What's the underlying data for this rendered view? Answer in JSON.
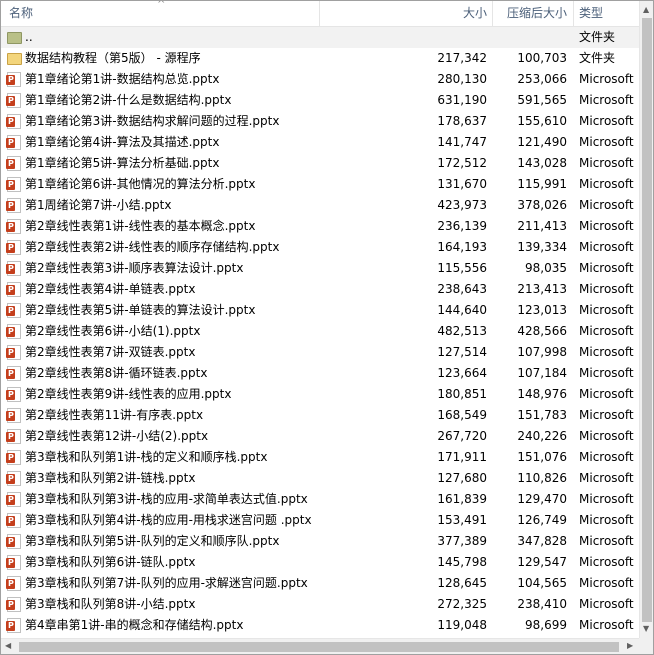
{
  "header": {
    "name": "名称",
    "size": "大小",
    "compressed": "压缩后大小",
    "type": "类型",
    "sort_arrow": "^"
  },
  "rows": [
    {
      "name": "..",
      "size": "",
      "compressed": "",
      "type": "文件夹",
      "icon": "folder-up"
    },
    {
      "name": "数据结构教程（第5版） - 源程序",
      "size": "217,342",
      "compressed": "100,703",
      "type": "文件夹",
      "icon": "folder"
    },
    {
      "name": "第1章绪论第1讲-数据结构总览.pptx",
      "size": "280,130",
      "compressed": "253,066",
      "type": "Microsoft",
      "icon": "pptx"
    },
    {
      "name": "第1章绪论第2讲-什么是数据结构.pptx",
      "size": "631,190",
      "compressed": "591,565",
      "type": "Microsoft",
      "icon": "pptx"
    },
    {
      "name": "第1章绪论第3讲-数据结构求解问题的过程.pptx",
      "size": "178,637",
      "compressed": "155,610",
      "type": "Microsoft",
      "icon": "pptx"
    },
    {
      "name": "第1章绪论第4讲-算法及其描述.pptx",
      "size": "141,747",
      "compressed": "121,490",
      "type": "Microsoft",
      "icon": "pptx"
    },
    {
      "name": "第1章绪论第5讲-算法分析基础.pptx",
      "size": "172,512",
      "compressed": "143,028",
      "type": "Microsoft",
      "icon": "pptx"
    },
    {
      "name": "第1章绪论第6讲-其他情况的算法分析.pptx",
      "size": "131,670",
      "compressed": "115,991",
      "type": "Microsoft",
      "icon": "pptx"
    },
    {
      "name": "第1周绪论第7讲-小结.pptx",
      "size": "423,973",
      "compressed": "378,026",
      "type": "Microsoft",
      "icon": "pptx"
    },
    {
      "name": "第2章线性表第1讲-线性表的基本概念.pptx",
      "size": "236,139",
      "compressed": "211,413",
      "type": "Microsoft",
      "icon": "pptx"
    },
    {
      "name": "第2章线性表第2讲-线性表的顺序存储结构.pptx",
      "size": "164,193",
      "compressed": "139,334",
      "type": "Microsoft",
      "icon": "pptx"
    },
    {
      "name": "第2章线性表第3讲-顺序表算法设计.pptx",
      "size": "115,556",
      "compressed": "98,035",
      "type": "Microsoft",
      "icon": "pptx"
    },
    {
      "name": "第2章线性表第4讲-单链表.pptx",
      "size": "238,643",
      "compressed": "213,413",
      "type": "Microsoft",
      "icon": "pptx"
    },
    {
      "name": "第2章线性表第5讲-单链表的算法设计.pptx",
      "size": "144,640",
      "compressed": "123,013",
      "type": "Microsoft",
      "icon": "pptx"
    },
    {
      "name": "第2章线性表第6讲-小结(1).pptx",
      "size": "482,513",
      "compressed": "428,566",
      "type": "Microsoft",
      "icon": "pptx"
    },
    {
      "name": "第2章线性表第7讲-双链表.pptx",
      "size": "127,514",
      "compressed": "107,998",
      "type": "Microsoft",
      "icon": "pptx"
    },
    {
      "name": "第2章线性表第8讲-循环链表.pptx",
      "size": "123,664",
      "compressed": "107,184",
      "type": "Microsoft",
      "icon": "pptx"
    },
    {
      "name": "第2章线性表第9讲-线性表的应用.pptx",
      "size": "180,851",
      "compressed": "148,976",
      "type": "Microsoft",
      "icon": "pptx"
    },
    {
      "name": "第2章线性表第11讲-有序表.pptx",
      "size": "168,549",
      "compressed": "151,783",
      "type": "Microsoft",
      "icon": "pptx"
    },
    {
      "name": "第2章线性表第12讲-小结(2).pptx",
      "size": "267,720",
      "compressed": "240,226",
      "type": "Microsoft",
      "icon": "pptx"
    },
    {
      "name": "第3章栈和队列第1讲-栈的定义和顺序栈.pptx",
      "size": "171,911",
      "compressed": "151,076",
      "type": "Microsoft",
      "icon": "pptx"
    },
    {
      "name": "第3章栈和队列第2讲-链栈.pptx",
      "size": "127,680",
      "compressed": "110,826",
      "type": "Microsoft",
      "icon": "pptx"
    },
    {
      "name": "第3章栈和队列第3讲-栈的应用-求简单表达式值.pptx",
      "size": "161,839",
      "compressed": "129,470",
      "type": "Microsoft",
      "icon": "pptx"
    },
    {
      "name": "第3章栈和队列第4讲-栈的应用-用栈求迷宫问题 .pptx",
      "size": "153,491",
      "compressed": "126,749",
      "type": "Microsoft",
      "icon": "pptx"
    },
    {
      "name": "第3章栈和队列第5讲-队列的定义和顺序队.pptx",
      "size": "377,389",
      "compressed": "347,828",
      "type": "Microsoft",
      "icon": "pptx"
    },
    {
      "name": "第3章栈和队列第6讲-链队.pptx",
      "size": "145,798",
      "compressed": "129,547",
      "type": "Microsoft",
      "icon": "pptx"
    },
    {
      "name": "第3章栈和队列第7讲-队列的应用-求解迷宫问题.pptx",
      "size": "128,645",
      "compressed": "104,565",
      "type": "Microsoft",
      "icon": "pptx"
    },
    {
      "name": "第3章栈和队列第8讲-小结.pptx",
      "size": "272,325",
      "compressed": "238,410",
      "type": "Microsoft",
      "icon": "pptx"
    },
    {
      "name": "第4章串第1讲-串的概念和存储结构.pptx",
      "size": "119,048",
      "compressed": "98,699",
      "type": "Microsoft",
      "icon": "pptx"
    }
  ],
  "scroll": {
    "up": "▲",
    "down": "▼",
    "left": "◀",
    "right": "▶"
  }
}
